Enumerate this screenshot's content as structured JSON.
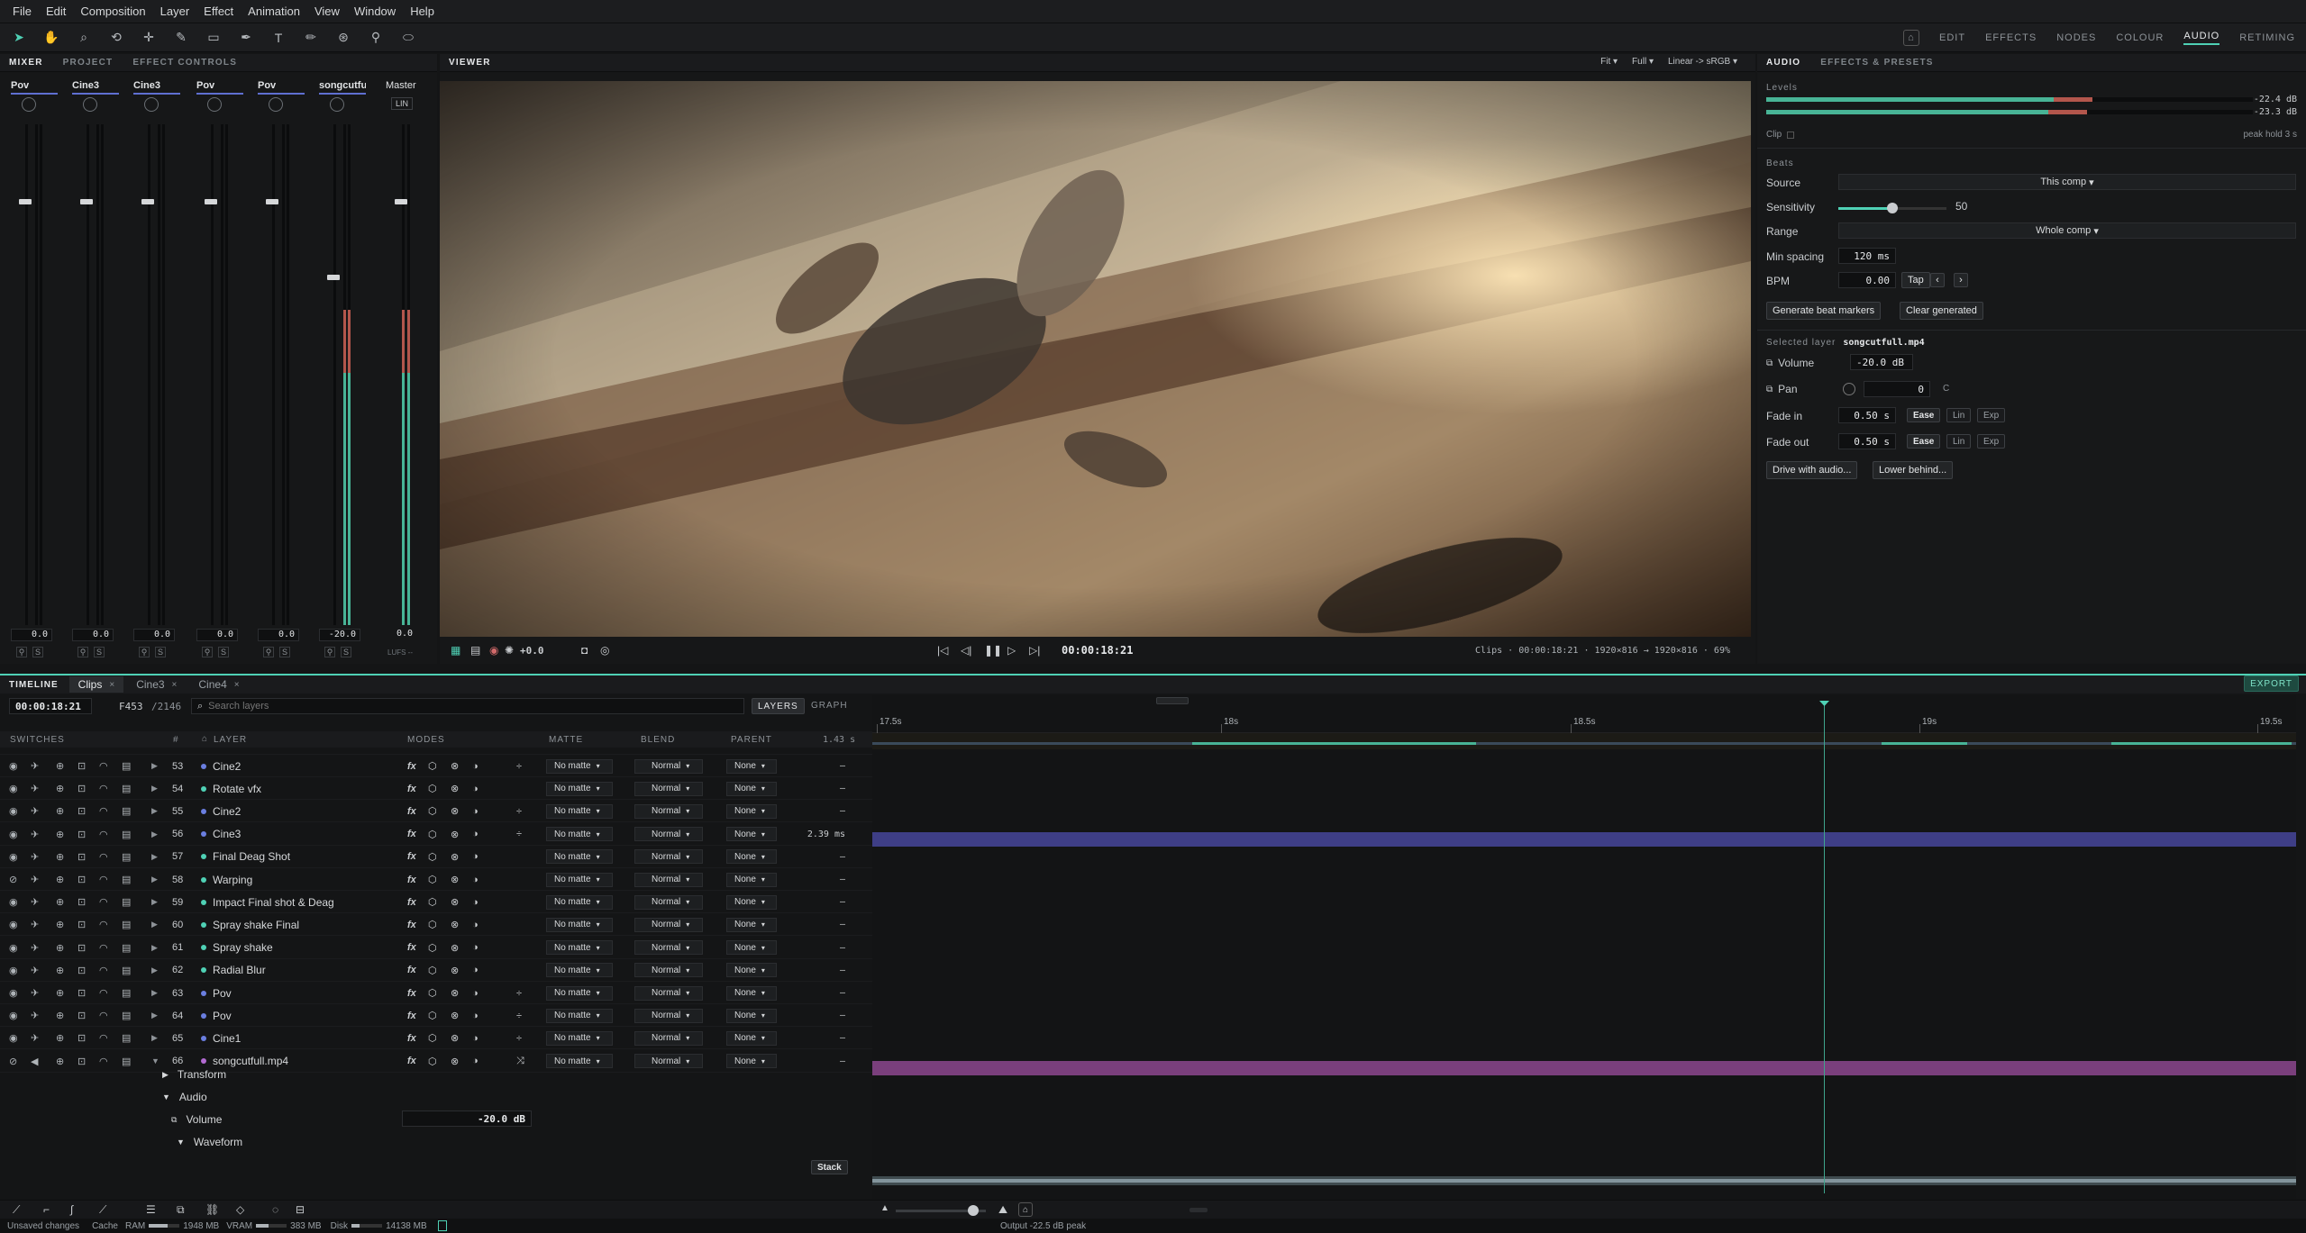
{
  "menu": [
    "File",
    "Edit",
    "Composition",
    "Layer",
    "Effect",
    "Animation",
    "View",
    "Window",
    "Help"
  ],
  "workspaces": [
    {
      "label": "EDIT",
      "active": false
    },
    {
      "label": "EFFECTS",
      "active": false
    },
    {
      "label": "NODES",
      "active": false
    },
    {
      "label": "COLOUR",
      "active": false
    },
    {
      "label": "AUDIO",
      "active": true
    },
    {
      "label": "RETIMING",
      "active": false
    }
  ],
  "tools": [
    "select-tool",
    "hand-tool",
    "zoom-tool",
    "rotate-tool",
    "anchor-tool",
    "brush-tool",
    "rectangle-tool",
    "pen-tool",
    "text-tool",
    "paint-tool",
    "clone-tool",
    "pin-tool",
    "mask-tool"
  ],
  "left_tabs": [
    {
      "label": "MIXER",
      "active": true
    },
    {
      "label": "PROJECT",
      "active": false
    },
    {
      "label": "EFFECT CONTROLS",
      "active": false
    }
  ],
  "mixer": {
    "channels": [
      {
        "name": "Pov",
        "value": "0.0",
        "fader": 0.15,
        "level": 0
      },
      {
        "name": "Cine3",
        "value": "0.0",
        "fader": 0.15,
        "level": 0
      },
      {
        "name": "Cine3",
        "value": "0.0",
        "fader": 0.15,
        "level": 0
      },
      {
        "name": "Pov",
        "value": "0.0",
        "fader": 0.15,
        "level": 0
      },
      {
        "name": "Pov",
        "value": "0.0",
        "fader": 0.15,
        "level": 0
      },
      {
        "name": "songcutfu...",
        "value": "-20.0",
        "fader": 0.3,
        "level": 0.63
      }
    ],
    "master": {
      "name": "Master",
      "badge": "LIN",
      "value": "0.0",
      "level": 0.63,
      "footer": "LUFS --"
    }
  },
  "viewer": {
    "title": "VIEWER",
    "fit": "Fit",
    "quality": "Full",
    "color": "Linear -> sRGB",
    "exposure": "+0.0",
    "timecode": "00:00:18:21",
    "info": "Clips · 00:00:18:21 · 1920×816 → 1920×816 · 69%"
  },
  "audio_panel": {
    "tabs": [
      {
        "label": "AUDIO",
        "active": true
      },
      {
        "label": "EFFECTS & PRESETS",
        "active": false
      }
    ],
    "levels_label": "Levels",
    "level_left": "-22.4 dB",
    "level_right": "-23.3 dB",
    "clip_label": "Clip",
    "peak_hold": "peak hold 3 s",
    "beats_label": "Beats",
    "source_label": "Source",
    "source_value": "This comp",
    "sensitivity_label": "Sensitivity",
    "sensitivity_value": "50",
    "sensitivity_fraction": 0.5,
    "range_label": "Range",
    "range_value": "Whole comp",
    "min_spacing_label": "Min spacing",
    "min_spacing_value": "120 ms",
    "bpm_label": "BPM",
    "bpm_value": "0.00",
    "tap_label": "Tap",
    "generate_label": "Generate beat markers",
    "clear_label": "Clear generated",
    "selected_label": "Selected layer",
    "selected_name": "songcutfull.mp4",
    "volume_label": "Volume",
    "volume_value": "-20.0 dB",
    "pan_label": "Pan",
    "pan_value": "0",
    "pan_unit": "C",
    "fade_in_label": "Fade in",
    "fade_in_value": "0.50 s",
    "fade_out_label": "Fade out",
    "fade_out_value": "0.50 s",
    "ease_label": "Ease",
    "lin_label": "Lin",
    "exp_label": "Exp",
    "drive_label": "Drive with audio...",
    "lower_label": "Lower behind..."
  },
  "timeline": {
    "label": "TIMELINE",
    "tabs": [
      {
        "label": "Clips",
        "active": true
      },
      {
        "label": "Cine3",
        "active": false
      },
      {
        "label": "Cine4",
        "active": false
      }
    ],
    "export_label": "EXPORT",
    "timecode": "00:00:18:21",
    "frame": "F453",
    "total": "/2146",
    "search_placeholder": "Search layers",
    "layers_label": "LAYERS",
    "graph_label": "GRAPH",
    "duration": "1.43 s",
    "headers": {
      "switches": "SWITCHES",
      "num": "#",
      "layer": "LAYER",
      "modes": "MODES",
      "matte": "MATTE",
      "blend": "BLEND",
      "parent": "PARENT"
    },
    "ruler": [
      "17.5s",
      "18s",
      "18.5s",
      "19s",
      "19.5s"
    ],
    "rows": [
      {
        "num": "53",
        "name": "Cine2",
        "color": "#6a7ee0",
        "matte": "No matte",
        "blend": "Normal",
        "parent": "None",
        "extra": "–",
        "visible": true,
        "adjust": true
      },
      {
        "num": "54",
        "name": "Rotate vfx",
        "color": "#4fd1b5",
        "matte": "No matte",
        "blend": "Normal",
        "parent": "None",
        "extra": "–",
        "visible": true,
        "adjust": false
      },
      {
        "num": "55",
        "name": "Cine2",
        "color": "#6a7ee0",
        "matte": "No matte",
        "blend": "Normal",
        "parent": "None",
        "extra": "–",
        "visible": true,
        "adjust": true
      },
      {
        "num": "56",
        "name": "Cine3",
        "color": "#6a7ee0",
        "matte": "No matte",
        "blend": "Normal",
        "parent": "None",
        "extra": "2.39 ms",
        "visible": true,
        "adjust": true
      },
      {
        "num": "57",
        "name": "Final Deag Shot",
        "color": "#4fd1b5",
        "matte": "No matte",
        "blend": "Normal",
        "parent": "None",
        "extra": "–",
        "visible": true,
        "adjust": false
      },
      {
        "num": "58",
        "name": "Warping",
        "color": "#4fd1b5",
        "matte": "No matte",
        "blend": "Normal",
        "parent": "None",
        "extra": "–",
        "visible": false,
        "adjust": false
      },
      {
        "num": "59",
        "name": "Impact Final shot & Deag",
        "color": "#4fd1b5",
        "matte": "No matte",
        "blend": "Normal",
        "parent": "None",
        "extra": "–",
        "visible": true,
        "adjust": false
      },
      {
        "num": "60",
        "name": "Spray shake Final",
        "color": "#4fd1b5",
        "matte": "No matte",
        "blend": "Normal",
        "parent": "None",
        "extra": "–",
        "visible": true,
        "adjust": false
      },
      {
        "num": "61",
        "name": "Spray shake",
        "color": "#4fd1b5",
        "matte": "No matte",
        "blend": "Normal",
        "parent": "None",
        "extra": "–",
        "visible": true,
        "adjust": false
      },
      {
        "num": "62",
        "name": "Radial Blur",
        "color": "#4fd1b5",
        "matte": "No matte",
        "blend": "Normal",
        "parent": "None",
        "extra": "–",
        "visible": true,
        "adjust": false
      },
      {
        "num": "63",
        "name": "Pov",
        "color": "#6a7ee0",
        "matte": "No matte",
        "blend": "Normal",
        "parent": "None",
        "extra": "–",
        "visible": true,
        "adjust": true
      },
      {
        "num": "64",
        "name": "Pov",
        "color": "#6a7ee0",
        "matte": "No matte",
        "blend": "Normal",
        "parent": "None",
        "extra": "–",
        "visible": true,
        "adjust": true
      },
      {
        "num": "65",
        "name": "Cine1",
        "color": "#6a7ee0",
        "matte": "No matte",
        "blend": "Normal",
        "parent": "None",
        "extra": "–",
        "visible": true,
        "adjust": true
      },
      {
        "num": "66",
        "name": "songcutfull.mp4",
        "color": "#b26ad1",
        "matte": "No matte",
        "blend": "Normal",
        "parent": "None",
        "extra": "–",
        "visible": false,
        "adjust": false
      }
    ],
    "props": {
      "transform": "Transform",
      "audio": "Audio",
      "volume": "Volume",
      "volume_value": "-20.0 dB",
      "waveform": "Waveform",
      "stack": "Stack"
    }
  },
  "status": {
    "unsaved": "Unsaved changes",
    "cache": "Cache",
    "ram_label": "RAM",
    "ram_value": "1948 MB",
    "vram_label": "VRAM",
    "vram_value": "383 MB",
    "disk_label": "Disk",
    "disk_value": "14138 MB",
    "output": "Output -22.5 dB peak"
  },
  "colors": {
    "accent": "#4fd1b5",
    "meter_red": "#b3564c",
    "video_track": "#3e3e86",
    "audio_track": "#7a3f7c"
  }
}
